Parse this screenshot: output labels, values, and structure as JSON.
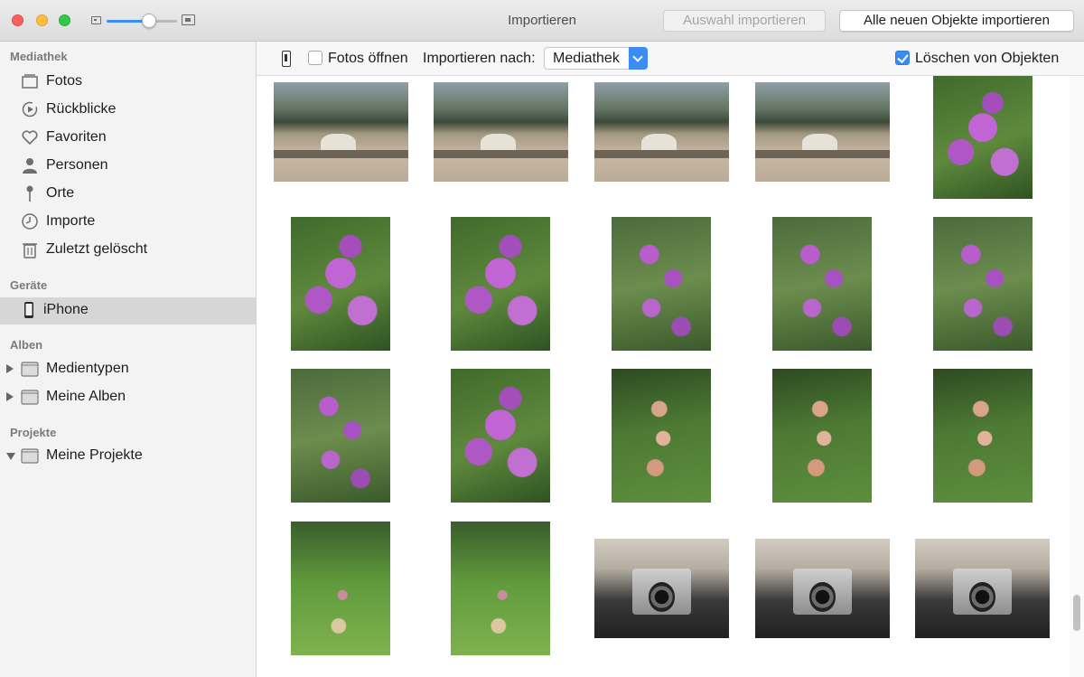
{
  "window": {
    "title": "Importieren",
    "import_selection_label": "Auswahl importieren",
    "import_all_label": "Alle neuen Objekte importieren",
    "zoom_level": 0.6
  },
  "sidebar": {
    "sections": [
      {
        "label": "Mediathek",
        "items": [
          {
            "label": "Fotos",
            "icon": "photos-icon"
          },
          {
            "label": "Rückblicke",
            "icon": "memories-icon"
          },
          {
            "label": "Favoriten",
            "icon": "heart-icon"
          },
          {
            "label": "Personen",
            "icon": "person-icon"
          },
          {
            "label": "Orte",
            "icon": "pin-icon"
          },
          {
            "label": "Importe",
            "icon": "clock-icon"
          },
          {
            "label": "Zuletzt gelöscht",
            "icon": "trash-icon"
          }
        ]
      },
      {
        "label": "Geräte",
        "items": [
          {
            "label": "iPhone",
            "icon": "iphone-icon",
            "selected": true
          }
        ]
      },
      {
        "label": "Alben",
        "items": [
          {
            "label": "Medientypen",
            "icon": "folder-icon",
            "expanded": false
          },
          {
            "label": "Meine Alben",
            "icon": "folder-icon",
            "expanded": false
          }
        ]
      },
      {
        "label": "Projekte",
        "items": [
          {
            "label": "Meine Projekte",
            "icon": "folder-icon",
            "expanded": true
          }
        ]
      }
    ]
  },
  "toolbar": {
    "open_photos_label": "Fotos öffnen",
    "open_photos_checked": false,
    "import_to_label": "Importieren nach:",
    "import_to_value": "Mediathek",
    "delete_items_label": "Löschen von Objekten",
    "delete_items_checked": true
  },
  "colors": {
    "accent": "#3b8cf6",
    "sidebar_bg": "#f3f3f3",
    "selected_bg": "#d6d6d6"
  }
}
